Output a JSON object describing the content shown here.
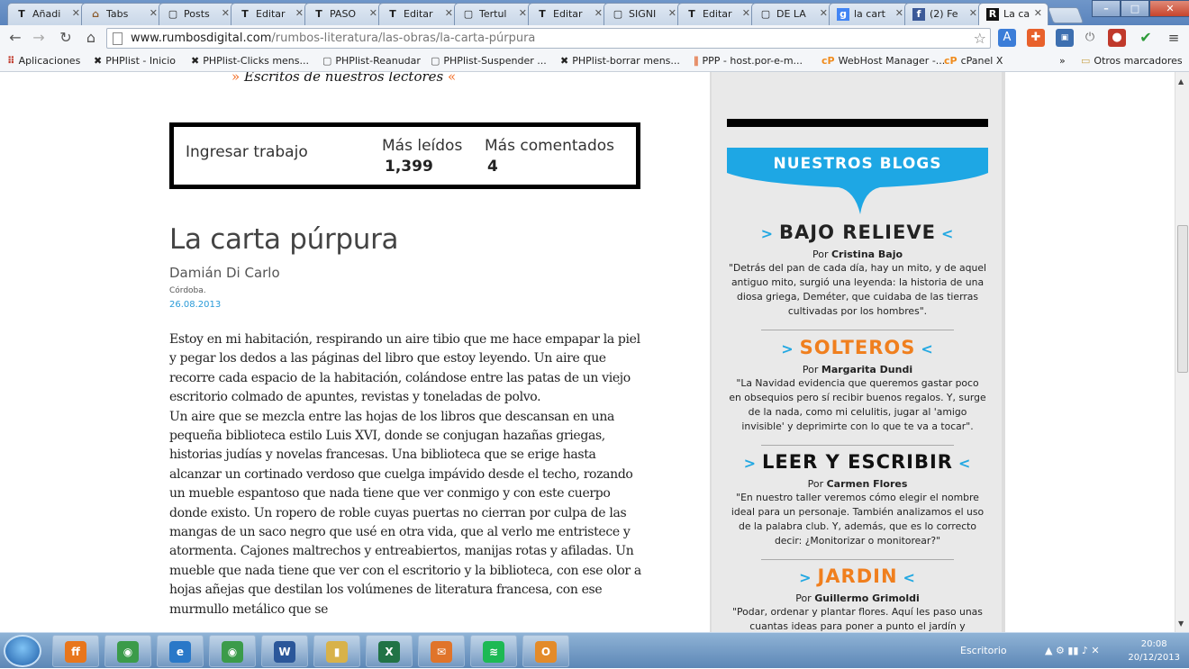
{
  "tabs": [
    {
      "title": "Añadi",
      "icon": "T"
    },
    {
      "title": "Tabs",
      "icon": "house"
    },
    {
      "title": "Posts",
      "icon": "page"
    },
    {
      "title": "Editar",
      "icon": "T"
    },
    {
      "title": "PASO",
      "icon": "T"
    },
    {
      "title": "Editar",
      "icon": "T"
    },
    {
      "title": "Tertul",
      "icon": "page"
    },
    {
      "title": "Editar",
      "icon": "T"
    },
    {
      "title": "SIGNI",
      "icon": "page"
    },
    {
      "title": "Editar",
      "icon": "T"
    },
    {
      "title": "DE LA",
      "icon": "page"
    },
    {
      "title": "la cart",
      "icon": "google"
    },
    {
      "title": "(2) Fe",
      "icon": "facebook"
    },
    {
      "title": "La car",
      "icon": "rumbos"
    }
  ],
  "address": {
    "host": "www.rumbosdigital.com",
    "path": "/rumbos-literatura/las-obras/la-carta-púrpura"
  },
  "bookmarks": [
    {
      "label": "Aplicaciones",
      "icon": "grid"
    },
    {
      "label": "PHPlist - Inicio",
      "icon": "x-logo"
    },
    {
      "label": "PHPlist-Clicks mens...",
      "icon": "x-logo"
    },
    {
      "label": "PHPlist-Reanudar",
      "icon": "page"
    },
    {
      "label": "PHPlist-Suspender ...",
      "icon": "page"
    },
    {
      "label": "PHPlist-borrar mens...",
      "icon": "x-logo"
    },
    {
      "label": "PPP - host.por-e-m...",
      "icon": "bars"
    },
    {
      "label": "WebHost Manager -...",
      "icon": "cp"
    },
    {
      "label": "cPanel X",
      "icon": "cp"
    },
    {
      "label": "»",
      "icon": ""
    },
    {
      "label": "Otros marcadores",
      "icon": "folder"
    }
  ],
  "page": {
    "escritos": "Escritos de nuestros lectores",
    "escritos_left": "»",
    "escritos_right": "«",
    "ingresar": "Ingresar trabajo",
    "mas_leidos_label": "Más leídos",
    "mas_leidos_value": "1,399",
    "mas_comentados_label": "Más comentados",
    "mas_comentados_value": "4",
    "title": "La carta púrpura",
    "author": "Damián Di Carlo",
    "place": "Córdoba.",
    "date": "26.08.2013",
    "body": "Estoy en mi habitación, respirando un aire tibio que me hace empapar la piel y pegar los dedos a las páginas del libro que estoy leyendo. Un aire que recorre cada espacio de la habitación, colándose entre las patas de un viejo escritorio colmado de apuntes, revistas y toneladas de polvo.\nUn aire que se mezcla entre las hojas de los libros que descansan en una pequeña biblioteca estilo Luis XVI, donde se conjugan hazañas griegas, historias judías y novelas francesas. Una biblioteca que se erige hasta alcanzar un cortinado verdoso que cuelga impávido desde el techo, rozando un mueble espantoso que nada tiene que ver conmigo y con este cuerpo donde existo. Un ropero de roble cuyas puertas no cierran por culpa de las mangas de un saco negro que usé en otra vida, que al verlo me entristece y atormenta. Cajones maltrechos y entreabiertos, manijas rotas y afiladas. Un mueble que nada tiene que ver con el escritorio y la biblioteca, con ese olor a hojas añejas que destilan los volúmenes de literatura francesa, con ese murmullo metálico que se"
  },
  "sidebar": {
    "banner": "NUESTROS BLOGS",
    "blogs": [
      {
        "name": "BAJO RELIEVE",
        "color": "#222222",
        "by_prefix": "Por",
        "by": "Cristina Bajo",
        "desc": "\"Detrás del pan de cada día, hay un mito, y de aquel antiguo mito, surgió una leyenda: la historia de una diosa griega, Deméter, que cuidaba de las tierras cultivadas por los hombres\"."
      },
      {
        "name": "SOLTEROS",
        "color": "#f07f1e",
        "by_prefix": "Por",
        "by": "Margarita Dundi",
        "desc": "\"La Navidad evidencia que queremos gastar poco en obsequios pero sí recibir buenos regalos. Y, surge de la nada, como mi celulitis, jugar al 'amigo invisible' y deprimirte con lo que te va a tocar\"."
      },
      {
        "name": "LEER Y ESCRIBIR",
        "color": "#111111",
        "by_prefix": "Por",
        "by": "Carmen Flores",
        "desc": "\"En nuestro taller veremos cómo elegir el nombre ideal para un personaje. También analizamos el uso de la palabra club. Y, además, que es lo correcto decir: ¿Monitorizar o monitorear?\""
      },
      {
        "name": "JARDIN",
        "color": "#f07f1e",
        "by_prefix": "Por",
        "by": "Guillermo Grimoldi",
        "desc": "\"Podar, ordenar y plantar flores. Aquí les paso unas cuantas ideas para poner a punto el jardín y"
      }
    ]
  },
  "taskbar": {
    "apps": [
      "firefox",
      "chrome",
      "internet-explorer",
      "chrome",
      "word",
      "explorer",
      "excel",
      "outlook-send",
      "spotify",
      "outlook"
    ],
    "desktop_label": "Escritorio",
    "time": "20:08",
    "date": "20/12/2013"
  }
}
